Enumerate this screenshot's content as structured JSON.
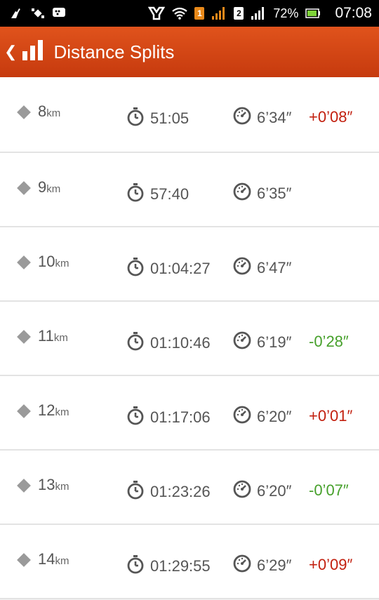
{
  "status_bar": {
    "sim1": "1",
    "sim2": "2",
    "battery": "72%",
    "time": "07:08"
  },
  "header": {
    "title": "Distance Splits",
    "back_icon": "chevron-left-icon",
    "chart_icon": "bar-chart-icon",
    "color": "#d54716"
  },
  "splits": [
    {
      "distance": "8",
      "unit": "km",
      "time": "51:05",
      "pace": "6’34″",
      "delta": "+0’08″",
      "delta_type": "pos"
    },
    {
      "distance": "9",
      "unit": "km",
      "time": "57:40",
      "pace": "6’35″",
      "delta": "",
      "delta_type": ""
    },
    {
      "distance": "10",
      "unit": "km",
      "time": "01:04:27",
      "pace": "6’47″",
      "delta": "",
      "delta_type": ""
    },
    {
      "distance": "11",
      "unit": "km",
      "time": "01:10:46",
      "pace": "6’19″",
      "delta": "-0’28″",
      "delta_type": "neg"
    },
    {
      "distance": "12",
      "unit": "km",
      "time": "01:17:06",
      "pace": "6’20″",
      "delta": "+0’01″",
      "delta_type": "pos"
    },
    {
      "distance": "13",
      "unit": "km",
      "time": "01:23:26",
      "pace": "6’20″",
      "delta": "-0’07″",
      "delta_type": "neg"
    },
    {
      "distance": "14",
      "unit": "km",
      "time": "01:29:55",
      "pace": "6’29″",
      "delta": "+0’09″",
      "delta_type": "pos"
    }
  ],
  "colors": {
    "positive_delta": "#c21f0e",
    "negative_delta": "#46a02b"
  }
}
